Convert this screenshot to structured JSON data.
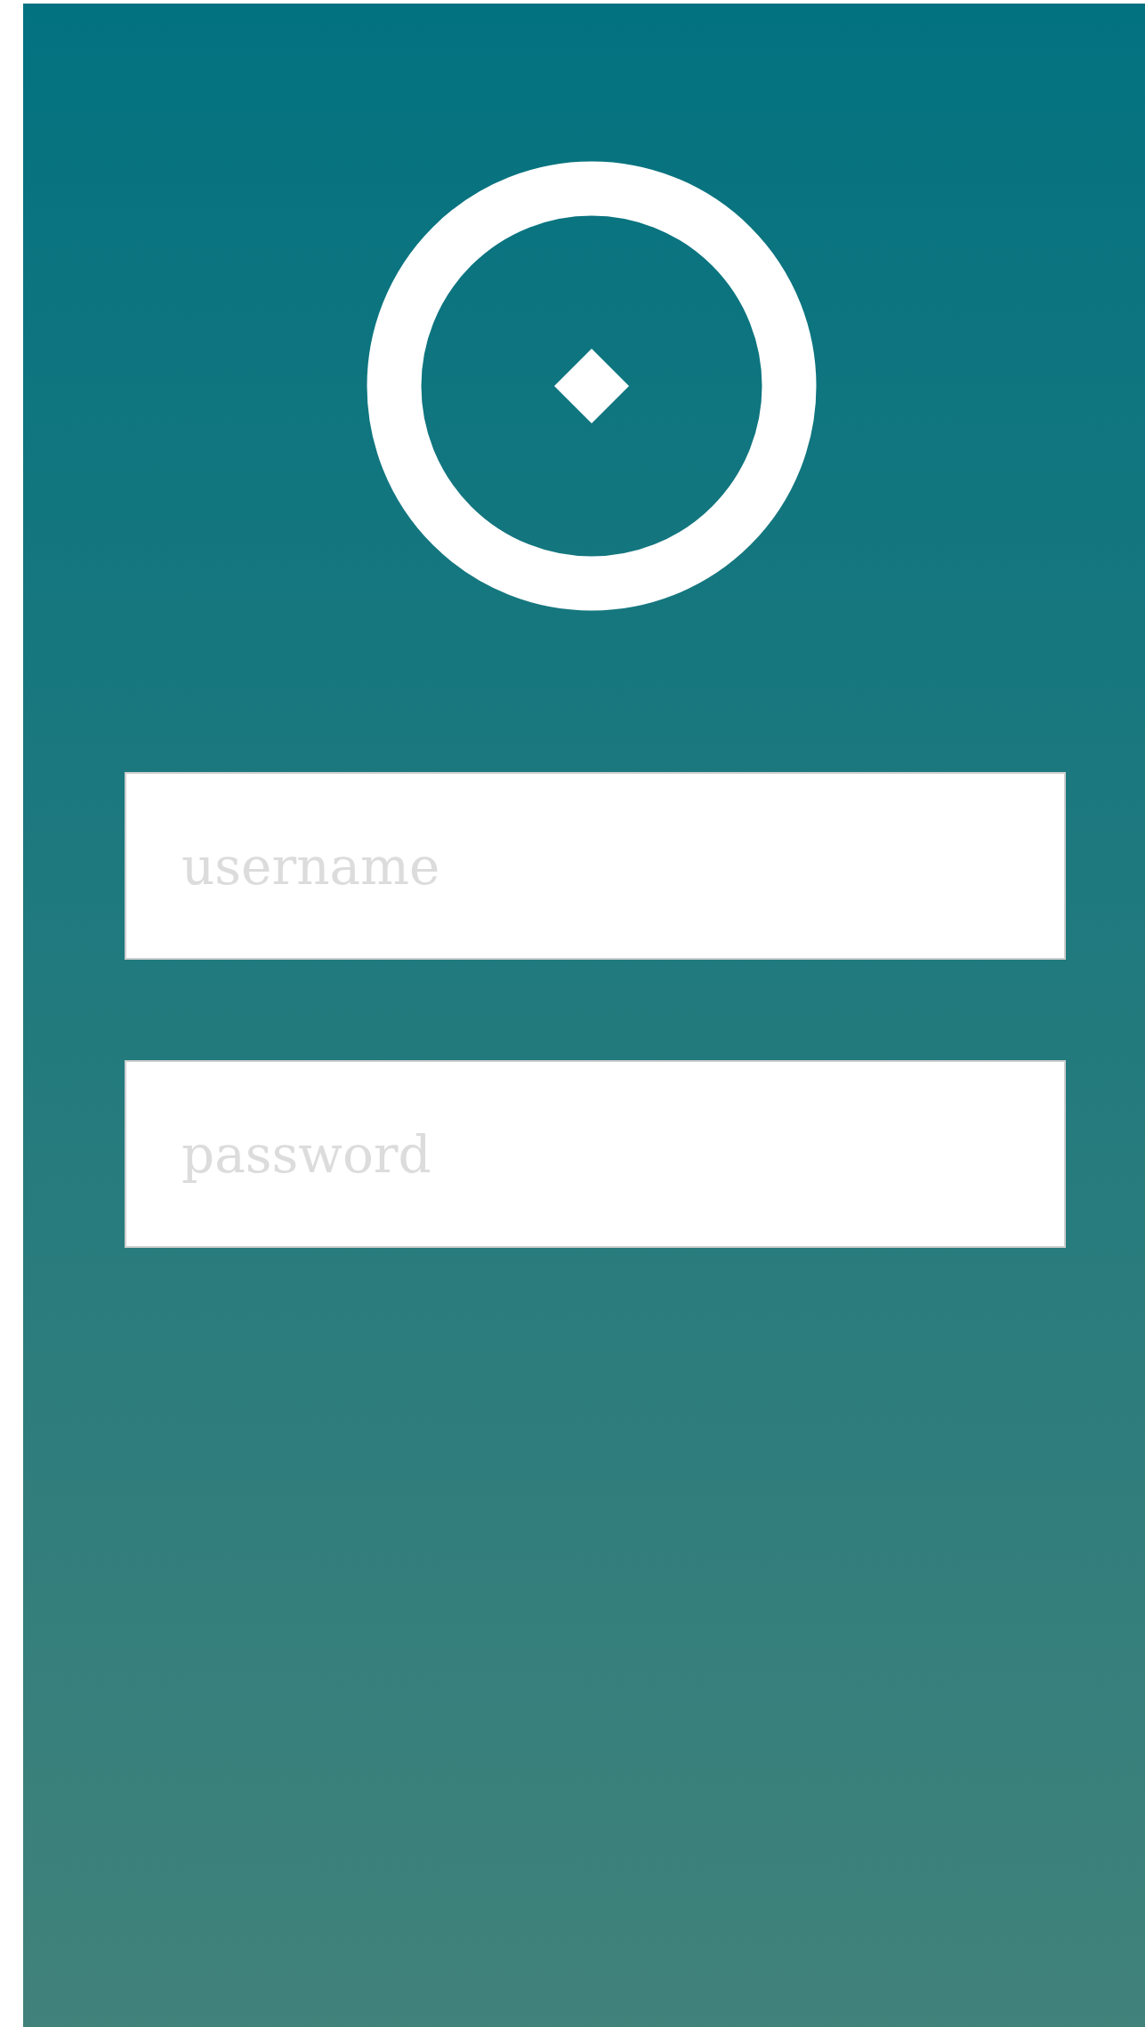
{
  "login_form": {
    "fields": [
      {
        "placeholder": "username"
      },
      {
        "placeholder": "password"
      }
    ]
  }
}
